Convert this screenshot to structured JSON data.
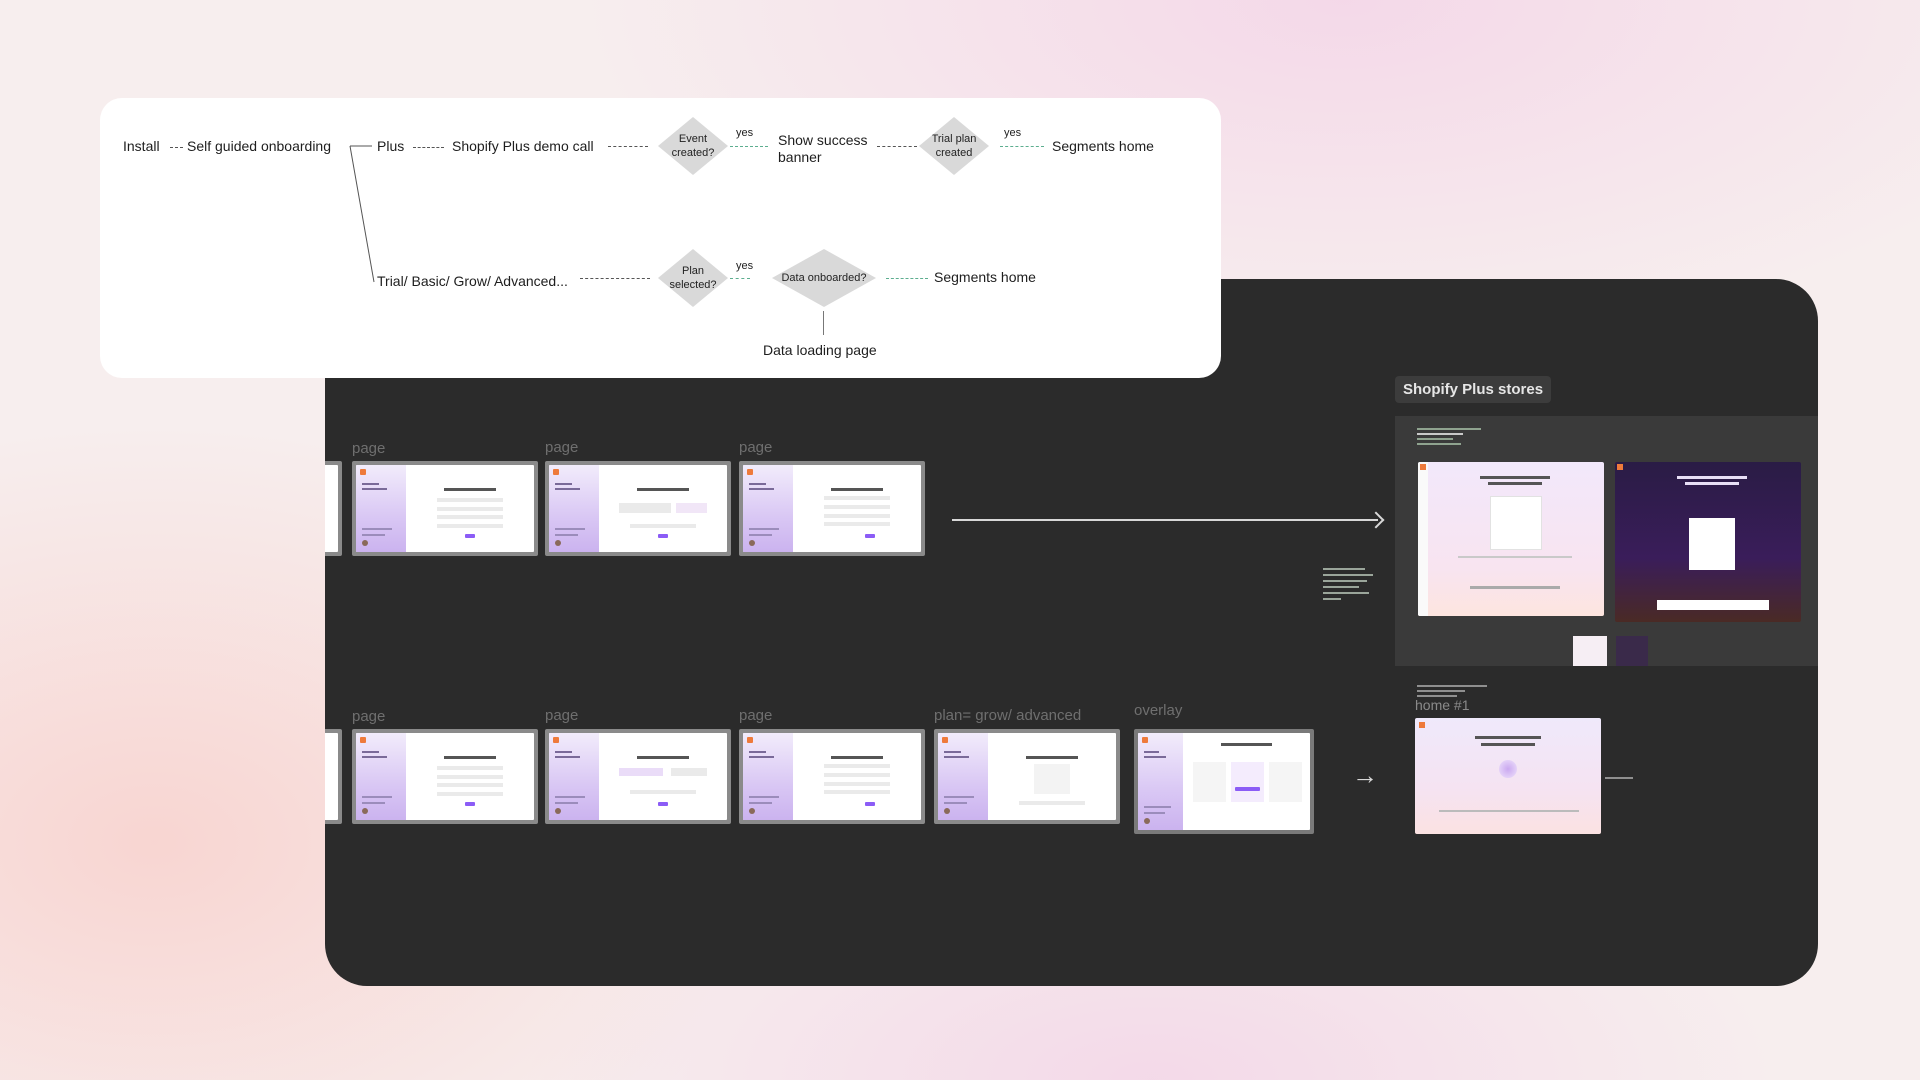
{
  "flowchart": {
    "install": "Install",
    "self_guided": "Self guided onboarding",
    "plus": "Plus",
    "demo_call": "Shopify Plus demo call",
    "event_created": "Event created?",
    "yes": "yes",
    "success_banner": "Show success banner",
    "trial_plan_created": "Trial plan created",
    "segments_home_1": "Segments home",
    "trial_basic": "Trial/ Basic/ Grow/ Advanced...",
    "plan_selected": "Plan selected?",
    "data_onboarded": "Data onboarded?",
    "segments_home_2": "Segments home",
    "data_loading_page": "Data loading page"
  },
  "canvas": {
    "row1_labels": [
      "page",
      "page",
      "page"
    ],
    "row2_labels": [
      "page",
      "page",
      "page",
      "plan= grow/ advanced",
      "overlay"
    ],
    "plus_badge": "Shopify Plus stores",
    "home_label": "home #1"
  },
  "colors": {
    "canvas_bg": "#2b2b2b",
    "card_bg": "#ffffff",
    "diamond": "#d9d9d9",
    "yes_connector": "#5cae8f",
    "accent_purple": "#8b5cf6",
    "brand_orange": "#ee7a3b"
  }
}
